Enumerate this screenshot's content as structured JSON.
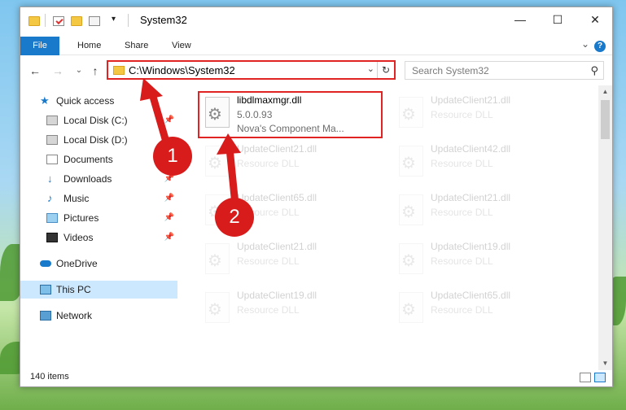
{
  "window": {
    "title": "System32"
  },
  "caption": {
    "minimize": "—",
    "maximize": "☐",
    "close": "✕"
  },
  "ribbon": {
    "file": "File",
    "tabs": [
      "Home",
      "Share",
      "View"
    ],
    "expand": "⌄",
    "help": "?"
  },
  "nav": {
    "back": "←",
    "forward": "→",
    "recent": "⌄",
    "up": "↑"
  },
  "address": {
    "path": "C:\\Windows\\System32",
    "dropdown": "⌄",
    "refresh": "↻"
  },
  "search": {
    "placeholder": "Search System32",
    "icon": "⚲"
  },
  "sidebar": {
    "items": [
      {
        "label": "Quick access",
        "icon": "star-icon",
        "pinned": false
      },
      {
        "label": "Local Disk (C:)",
        "icon": "drive-icon",
        "pinned": true
      },
      {
        "label": "Local Disk (D:)",
        "icon": "drive-icon",
        "pinned": false
      },
      {
        "label": "Documents",
        "icon": "documents-icon",
        "pinned": true
      },
      {
        "label": "Downloads",
        "icon": "download-icon",
        "pinned": true
      },
      {
        "label": "Music",
        "icon": "music-icon",
        "pinned": true
      },
      {
        "label": "Pictures",
        "icon": "pictures-icon",
        "pinned": true
      },
      {
        "label": "Videos",
        "icon": "videos-icon",
        "pinned": true
      },
      {
        "label": "OneDrive",
        "icon": "cloud-icon",
        "pinned": false
      },
      {
        "label": "This PC",
        "icon": "computer-icon",
        "pinned": false,
        "selected": true
      },
      {
        "label": "Network",
        "icon": "network-icon",
        "pinned": false
      }
    ],
    "pin_glyph": "📌"
  },
  "files": {
    "highlighted": {
      "name": "libdlmaxmgr.dll",
      "version": "5.0.0.93",
      "company": "Nova's Component Ma..."
    },
    "tiles": [
      {
        "name": "UpdateClient21.dll",
        "type": "Resource DLL"
      },
      {
        "name": "UpdateClient21.dll",
        "type": "Resource DLL"
      },
      {
        "name": "UpdateClient42.dll",
        "type": "Resource DLL"
      },
      {
        "name": "UpdateClient65.dll",
        "type": "Resource DLL"
      },
      {
        "name": "UpdateClient21.dll",
        "type": "Resource DLL"
      },
      {
        "name": "UpdateClient21.dll",
        "type": "Resource DLL"
      },
      {
        "name": "UpdateClient19.dll",
        "type": "Resource DLL"
      },
      {
        "name": "UpdateClient19.dll",
        "type": "Resource DLL"
      },
      {
        "name": "UpdateClient65.dll",
        "type": "Resource DLL"
      }
    ]
  },
  "status": {
    "count": "140 items"
  },
  "callouts": {
    "one": "1",
    "two": "2",
    "color": "#d81b1b"
  },
  "colors": {
    "accent": "#1979ca",
    "highlight": "#e02424",
    "selected": "#cce8ff"
  }
}
